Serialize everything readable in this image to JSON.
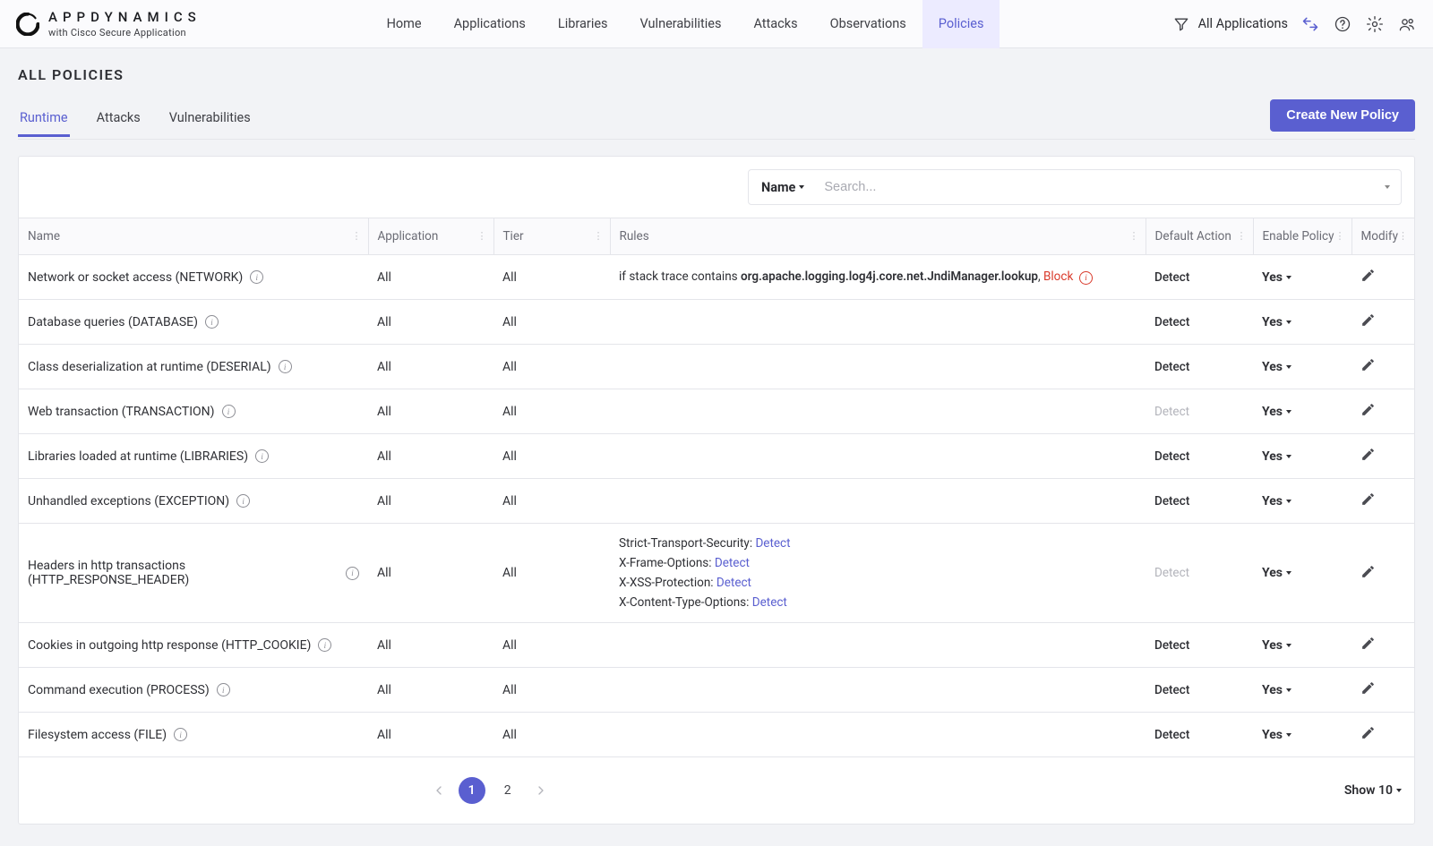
{
  "brand": {
    "title": "APPDYNAMICS",
    "subtitle": "with Cisco Secure Application"
  },
  "nav": {
    "items": [
      {
        "label": "Home",
        "active": false
      },
      {
        "label": "Applications",
        "active": false
      },
      {
        "label": "Libraries",
        "active": false
      },
      {
        "label": "Vulnerabilities",
        "active": false
      },
      {
        "label": "Attacks",
        "active": false
      },
      {
        "label": "Observations",
        "active": false
      },
      {
        "label": "Policies",
        "active": true
      }
    ]
  },
  "toolbar": {
    "apps_label": "All Applications"
  },
  "page": {
    "title": "ALL POLICIES",
    "tabs": [
      {
        "label": "Runtime",
        "active": true
      },
      {
        "label": "Attacks",
        "active": false
      },
      {
        "label": "Vulnerabilities",
        "active": false
      }
    ],
    "create_button": "Create New Policy"
  },
  "search": {
    "field_label": "Name",
    "placeholder": "Search..."
  },
  "table": {
    "columns": [
      "Name",
      "Application",
      "Tier",
      "Rules",
      "Default Action",
      "Enable Policy",
      "Modify"
    ],
    "yes_label": "Yes",
    "rows": [
      {
        "name": "Network or socket access (NETWORK)",
        "application": "All",
        "tier": "All",
        "rules": {
          "type": "inline",
          "prefix": "if stack trace contains ",
          "bold": "org.apache.logging.log4j.core.net.JndiManager.lookup",
          "sep": ", ",
          "action": "Block",
          "has_warning": true
        },
        "default_action": "Detect",
        "default_action_muted": false,
        "enable": "Yes"
      },
      {
        "name": "Database queries (DATABASE)",
        "application": "All",
        "tier": "All",
        "rules": {
          "type": "none"
        },
        "default_action": "Detect",
        "default_action_muted": false,
        "enable": "Yes"
      },
      {
        "name": "Class deserialization at runtime (DESERIAL)",
        "application": "All",
        "tier": "All",
        "rules": {
          "type": "none"
        },
        "default_action": "Detect",
        "default_action_muted": false,
        "enable": "Yes"
      },
      {
        "name": "Web transaction (TRANSACTION)",
        "application": "All",
        "tier": "All",
        "rules": {
          "type": "none"
        },
        "default_action": "Detect",
        "default_action_muted": true,
        "enable": "Yes"
      },
      {
        "name": "Libraries loaded at runtime (LIBRARIES)",
        "application": "All",
        "tier": "All",
        "rules": {
          "type": "none"
        },
        "default_action": "Detect",
        "default_action_muted": false,
        "enable": "Yes"
      },
      {
        "name": "Unhandled exceptions (EXCEPTION)",
        "application": "All",
        "tier": "All",
        "rules": {
          "type": "none"
        },
        "default_action": "Detect",
        "default_action_muted": false,
        "enable": "Yes"
      },
      {
        "name": "Headers in http transactions (HTTP_RESPONSE_HEADER)",
        "application": "All",
        "tier": "All",
        "rules": {
          "type": "headers",
          "lines": [
            {
              "label": "Strict-Transport-Security: ",
              "action": "Detect"
            },
            {
              "label": "X-Frame-Options: ",
              "action": "Detect"
            },
            {
              "label": "X-XSS-Protection: ",
              "action": "Detect"
            },
            {
              "label": "X-Content-Type-Options: ",
              "action": "Detect"
            }
          ]
        },
        "default_action": "Detect",
        "default_action_muted": true,
        "enable": "Yes"
      },
      {
        "name": "Cookies in outgoing http response (HTTP_COOKIE)",
        "application": "All",
        "tier": "All",
        "rules": {
          "type": "none"
        },
        "default_action": "Detect",
        "default_action_muted": false,
        "enable": "Yes"
      },
      {
        "name": "Command execution (PROCESS)",
        "application": "All",
        "tier": "All",
        "rules": {
          "type": "none"
        },
        "default_action": "Detect",
        "default_action_muted": false,
        "enable": "Yes"
      },
      {
        "name": "Filesystem access (FILE)",
        "application": "All",
        "tier": "All",
        "rules": {
          "type": "none"
        },
        "default_action": "Detect",
        "default_action_muted": false,
        "enable": "Yes"
      }
    ]
  },
  "pagination": {
    "pages": [
      "1",
      "2"
    ],
    "active": "1",
    "show_label": "Show 10"
  }
}
